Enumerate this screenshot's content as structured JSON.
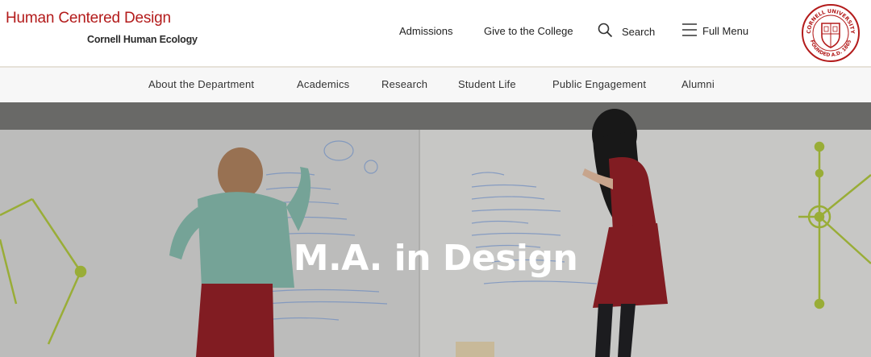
{
  "header": {
    "brand_title": "Human Centered Design",
    "brand_sub": "Cornell Human Ecology",
    "utility_links": [
      "Admissions",
      "Give to the College"
    ],
    "search_label": "Search",
    "menu_label": "Full Menu",
    "seal_text_top": "CORNELL UNIVERSITY",
    "seal_text_bottom": "FOUNDED A.D. 1865"
  },
  "nav": {
    "items": [
      "About the Department",
      "Academics",
      "Research",
      "Student Life",
      "Public Engagement",
      "Alumni"
    ]
  },
  "hero": {
    "title": "M.A. in Design"
  },
  "colors": {
    "brand_red": "#b31b1b",
    "nav_bg": "#f7f7f7",
    "accent_green": "#a6bc3c"
  }
}
